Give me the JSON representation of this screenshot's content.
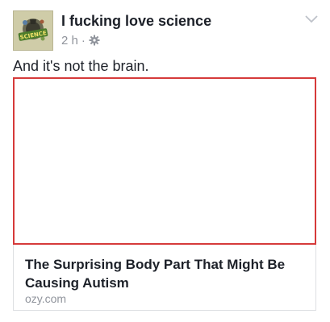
{
  "post": {
    "page_name": "I fucking love science",
    "timestamp": "2 h",
    "separator": "·",
    "privacy_icon": "gear-icon",
    "menu_icon": "chevron-down-icon",
    "text": "And it's not the brain."
  },
  "avatar": {
    "logo_text": "SCIENCE"
  },
  "link_card": {
    "title": "The Surprising Body Part That Might Be Causing Autism",
    "domain": "ozy.com"
  },
  "colors": {
    "text_primary": "#1d2129",
    "text_secondary": "#90949c",
    "image_border": "#d63a3a",
    "card_border": "#dddfe2"
  }
}
